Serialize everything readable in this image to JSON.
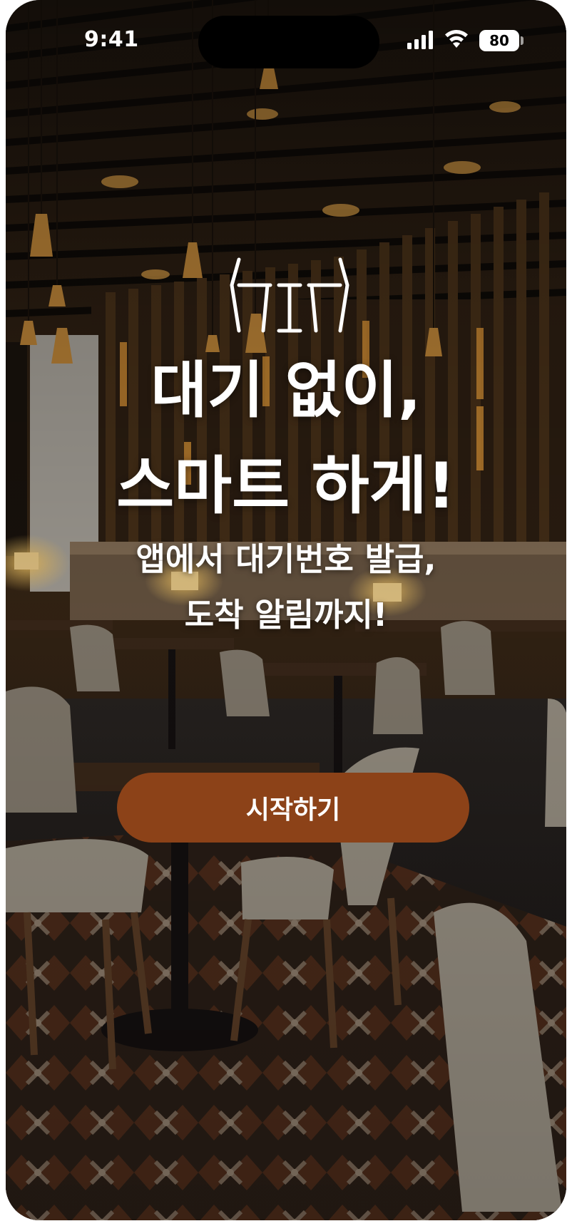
{
  "status_bar": {
    "time": "9:41",
    "battery": "80"
  },
  "brand": {
    "logo_text": "HTH"
  },
  "hero": {
    "headline_line1": "대기 없이,",
    "headline_line2": "스마트 하게!",
    "subtitle_line1": "앱에서 대기번호 발급,",
    "subtitle_line2": "도착 알림까지!"
  },
  "cta": {
    "start_label": "시작하기"
  },
  "colors": {
    "cta_background": "#8c4218",
    "text": "#ffffff"
  }
}
